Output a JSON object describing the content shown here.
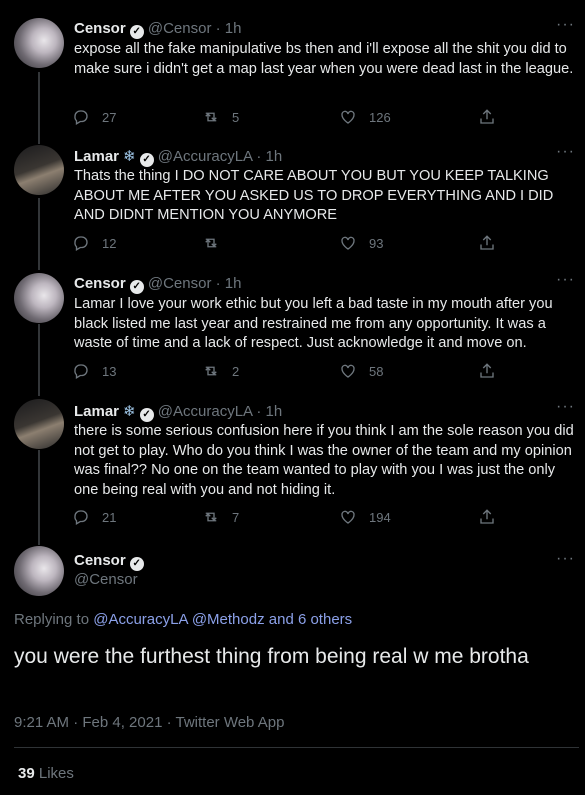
{
  "tweets": [
    {
      "name": "Censor",
      "handle": "@Censor",
      "time": "· 1h",
      "text": "expose all the fake manipulative bs then and i'll expose all the shit you did to make sure i didn't get a map last year when you were dead last in the league.",
      "replies": "27",
      "retweets": "5",
      "likes": "126"
    },
    {
      "name": "Lamar",
      "emoji": "❄",
      "handle": "@AccuracyLA",
      "time": "· 1h",
      "text": "Thats the thing I DO NOT CARE ABOUT YOU BUT YOU KEEP TALKING ABOUT ME AFTER YOU ASKED US TO DROP EVERYTHING AND I DID AND DIDNT MENTION YOU ANYMORE",
      "replies": "12",
      "retweets": "",
      "likes": "93"
    },
    {
      "name": "Censor",
      "handle": "@Censor",
      "time": "· 1h",
      "text": "Lamar I love your work ethic but you left a bad taste in my mouth after you black listed me last year and restrained me from any opportunity. It was a waste of time and a lack of respect. Just acknowledge it and move on.",
      "replies": "13",
      "retweets": "2",
      "likes": "58"
    },
    {
      "name": "Lamar",
      "emoji": "❄",
      "handle": "@AccuracyLA",
      "time": "· 1h",
      "text": "there is some serious confusion here if you think I am the sole reason you did not get to play. Who do you think I was the owner of the team and my opinion was final?? No one on the team wanted to play with you I was just the only one being real with you and not hiding it.",
      "replies": "21",
      "retweets": "7",
      "likes": "194"
    }
  ],
  "focus": {
    "name": "Censor",
    "handle": "@Censor",
    "replying_label": "Replying to",
    "replying_user1": "@AccuracyLA",
    "replying_user2": "@Methodz",
    "replying_rest": "and 6 others",
    "text": "you were the furthest thing from being real w me brotha",
    "time": "9:21 AM · Feb 4, 2021 · Twitter Web App",
    "likes_count": "39",
    "likes_label": "Likes"
  },
  "icons": [
    "reply-icon",
    "retweet-icon",
    "like-icon",
    "share-icon",
    "more-icon",
    "verified-badge-icon"
  ],
  "colors": {
    "background": "#000000",
    "text": "#e7e9ea",
    "secondary": "#6e767d",
    "link": "#8ba0e8"
  }
}
